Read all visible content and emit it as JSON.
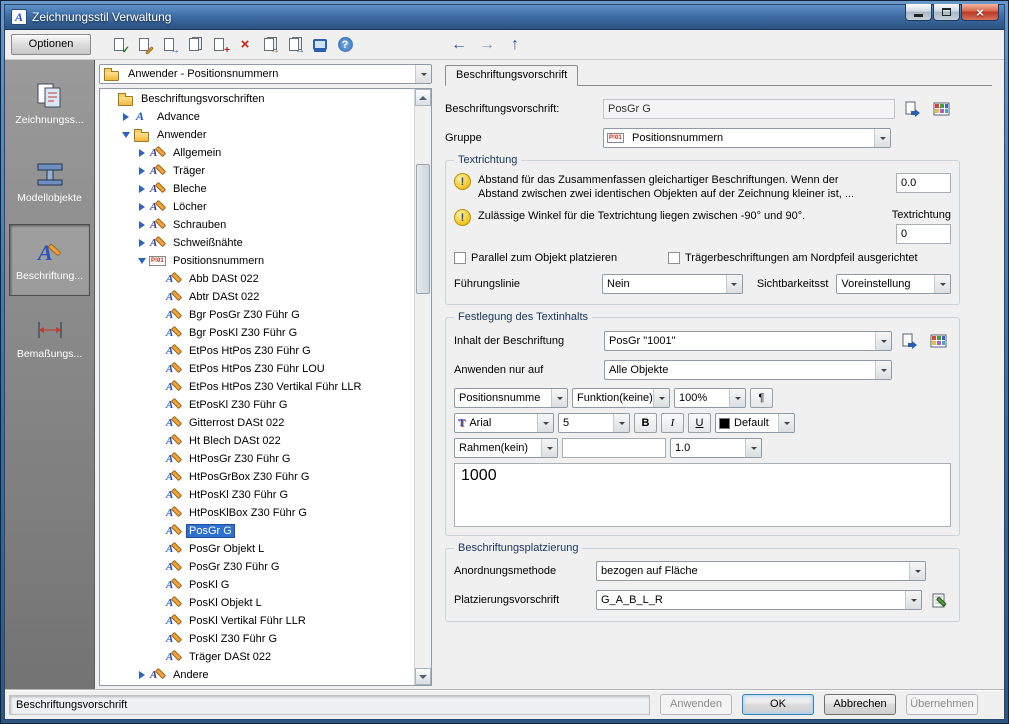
{
  "window": {
    "title": "Zeichnungsstil Verwaltung"
  },
  "toolbar": {
    "options_label": "Optionen",
    "buttons": [
      {
        "name": "new-style",
        "base": "page",
        "overlay": "check",
        "color": "#1a7a1a"
      },
      {
        "name": "edit-style",
        "base": "page",
        "overlay": "pencil",
        "color": "#b07a18"
      },
      {
        "name": "copy-style",
        "base": "page",
        "overlay": "arrow",
        "color": "#2458a8"
      },
      {
        "name": "copy",
        "base": "pages",
        "overlay": "none",
        "color": ""
      },
      {
        "name": "paste",
        "base": "page",
        "overlay": "plus",
        "color": "#b02018"
      },
      {
        "name": "delete",
        "base": "x",
        "overlay": "none",
        "color": "#cc2211"
      },
      {
        "name": "import-style",
        "base": "pages",
        "overlay": "arrow",
        "color": "#8a6a10"
      },
      {
        "name": "export-style",
        "base": "pages",
        "overlay": "arrow",
        "color": "#2458a8"
      },
      {
        "name": "preview",
        "base": "screen",
        "overlay": "none",
        "color": "#2b5fb0"
      },
      {
        "name": "help",
        "base": "help",
        "overlay": "none",
        "color": "#ffffff"
      }
    ],
    "nav": [
      {
        "name": "back",
        "glyph": "←",
        "color": "#2458a8"
      },
      {
        "name": "forward",
        "glyph": "→",
        "color": "#7f97b8"
      },
      {
        "name": "up",
        "glyph": "↑",
        "color": "#2458a8"
      }
    ]
  },
  "sidebar": {
    "items": [
      {
        "label": "Zeichnungss...",
        "selected": false
      },
      {
        "label": "Modellobjekte",
        "selected": false
      },
      {
        "label": "Beschriftung...",
        "selected": true
      },
      {
        "label": "Bemaßungs...",
        "selected": false
      }
    ]
  },
  "tree_panel": {
    "filter_value": "Anwender - Positionsnummern",
    "items": [
      {
        "depth": 0,
        "label": "Beschriftungsvorschriften",
        "icon": "folder-open",
        "expander": "none"
      },
      {
        "depth": 1,
        "label": "Advance",
        "icon": "advance",
        "expander": "collapsed"
      },
      {
        "depth": 1,
        "label": "Anwender",
        "icon": "folder-open",
        "expander": "expanded"
      },
      {
        "depth": 2,
        "label": "Allgemein",
        "icon": "category",
        "expander": "collapsed"
      },
      {
        "depth": 2,
        "label": "Träger",
        "icon": "category",
        "expander": "collapsed"
      },
      {
        "depth": 2,
        "label": "Bleche",
        "icon": "category",
        "expander": "collapsed"
      },
      {
        "depth": 2,
        "label": "Löcher",
        "icon": "category",
        "expander": "collapsed"
      },
      {
        "depth": 2,
        "label": "Schrauben",
        "icon": "category",
        "expander": "collapsed"
      },
      {
        "depth": 2,
        "label": "Schweißnähte",
        "icon": "category",
        "expander": "collapsed"
      },
      {
        "depth": 2,
        "label": "Positionsnummern",
        "icon": "posnum",
        "expander": "expanded"
      },
      {
        "depth": 3,
        "label": "Abb DASt 022",
        "icon": "leaf",
        "expander": "none"
      },
      {
        "depth": 3,
        "label": "Abtr DASt 022",
        "icon": "leaf",
        "expander": "none"
      },
      {
        "depth": 3,
        "label": "Bgr PosGr Z30 Führ G",
        "icon": "leaf",
        "expander": "none"
      },
      {
        "depth": 3,
        "label": "Bgr PosKl Z30 Führ G",
        "icon": "leaf",
        "expander": "none"
      },
      {
        "depth": 3,
        "label": "EtPos HtPos Z30 Führ G",
        "icon": "leaf",
        "expander": "none"
      },
      {
        "depth": 3,
        "label": "EtPos HtPos Z30 Führ LOU",
        "icon": "leaf",
        "expander": "none"
      },
      {
        "depth": 3,
        "label": "EtPos HtPos Z30 Vertikal Führ LLR",
        "icon": "leaf",
        "expander": "none"
      },
      {
        "depth": 3,
        "label": "EtPosKl Z30 Führ G",
        "icon": "leaf",
        "expander": "none"
      },
      {
        "depth": 3,
        "label": "Gitterrost DASt 022",
        "icon": "leaf",
        "expander": "none"
      },
      {
        "depth": 3,
        "label": "Ht Blech DASt 022",
        "icon": "leaf",
        "expander": "none"
      },
      {
        "depth": 3,
        "label": "HtPosGr Z30 Führ G",
        "icon": "leaf",
        "expander": "none"
      },
      {
        "depth": 3,
        "label": "HtPosGrBox Z30 Führ G",
        "icon": "leaf",
        "expander": "none"
      },
      {
        "depth": 3,
        "label": "HtPosKl Z30 Führ G",
        "icon": "leaf",
        "expander": "none"
      },
      {
        "depth": 3,
        "label": "HtPosKlBox Z30 Führ G",
        "icon": "leaf",
        "expander": "none"
      },
      {
        "depth": 3,
        "label": "PosGr G",
        "icon": "leaf",
        "expander": "none",
        "selected": true
      },
      {
        "depth": 3,
        "label": "PosGr Objekt L",
        "icon": "leaf",
        "expander": "none"
      },
      {
        "depth": 3,
        "label": "PosGr Z30 Führ G",
        "icon": "leaf",
        "expander": "none"
      },
      {
        "depth": 3,
        "label": "PosKl G",
        "icon": "leaf",
        "expander": "none"
      },
      {
        "depth": 3,
        "label": "PosKl Objekt L",
        "icon": "leaf",
        "expander": "none"
      },
      {
        "depth": 3,
        "label": "PosKl Vertikal Führ LLR",
        "icon": "leaf",
        "expander": "none"
      },
      {
        "depth": 3,
        "label": "PosKl Z30 Führ G",
        "icon": "leaf",
        "expander": "none"
      },
      {
        "depth": 3,
        "label": "Träger DASt 022",
        "icon": "leaf",
        "expander": "none"
      },
      {
        "depth": 2,
        "label": "Andere",
        "icon": "category",
        "expander": "collapsed"
      }
    ]
  },
  "main": {
    "tab_label": "Beschriftungsvorschrift",
    "fields": {
      "name_label": "Beschriftungsvorschrift:",
      "name_value": "PosGr G",
      "group_label": "Gruppe",
      "group_value": "Positionsnummern"
    },
    "textrichtung": {
      "title": "Textrichtung",
      "hint1_line1": "Abstand für das Zusammenfassen gleichartiger Beschriftungen. Wenn der",
      "hint1_line2": "Abstand  zwischen zwei identischen Objekten auf der Zeichnung kleiner ist, ...",
      "hint_glyph": "!",
      "distance_value": "0.0",
      "hint2": "Zulässige Winkel für die Textrichtung liegen zwischen -90° und 90°.",
      "direction_label": "Textrichtung",
      "direction_value": "0",
      "checkbox1": "Parallel zum Objekt platzieren",
      "checkbox2": "Trägerbeschriftungen am Nordpfeil ausgerichtet",
      "leader_label": "Führungslinie",
      "leader_value": "Nein",
      "visibility_label": "Sichtbarkeitsst",
      "visibility_value": "Voreinstellung"
    },
    "textinhalt": {
      "title": "Festlegung des Textinhalts",
      "content_label": "Inhalt der Beschriftung",
      "content_value": "PosGr \"1001\"",
      "apply_label": "Anwenden nur auf",
      "apply_value": "Alle Objekte",
      "token_value": "Positionsnumme",
      "function_value": "Funktion(keine)",
      "scale_value": "100%",
      "pilcrow": "¶",
      "font_value": "Arial",
      "font_icon_glyph": "T",
      "size_value": "5",
      "bold_label": "B",
      "italic_label": "I",
      "underline_label": "U",
      "color_value": "Default",
      "frame_value": "Rahmen(kein)",
      "frame_text_value": "",
      "spacing_value": "1.0",
      "preview_text": "1000"
    },
    "platzierung": {
      "title": "Beschriftungsplatzierung",
      "method_label": "Anordnungsmethode",
      "method_value": "bezogen auf Fläche",
      "rule_label": "Platzierungsvorschrift",
      "rule_value": "G_A_B_L_R"
    }
  },
  "footer": {
    "status": "Beschriftungsvorschrift",
    "buttons": [
      {
        "label": "Anwenden",
        "enabled": false
      },
      {
        "label": "OK",
        "enabled": true,
        "default": true
      },
      {
        "label": "Abbrechen",
        "enabled": true
      },
      {
        "label": "Übernehmen",
        "enabled": false
      }
    ]
  }
}
